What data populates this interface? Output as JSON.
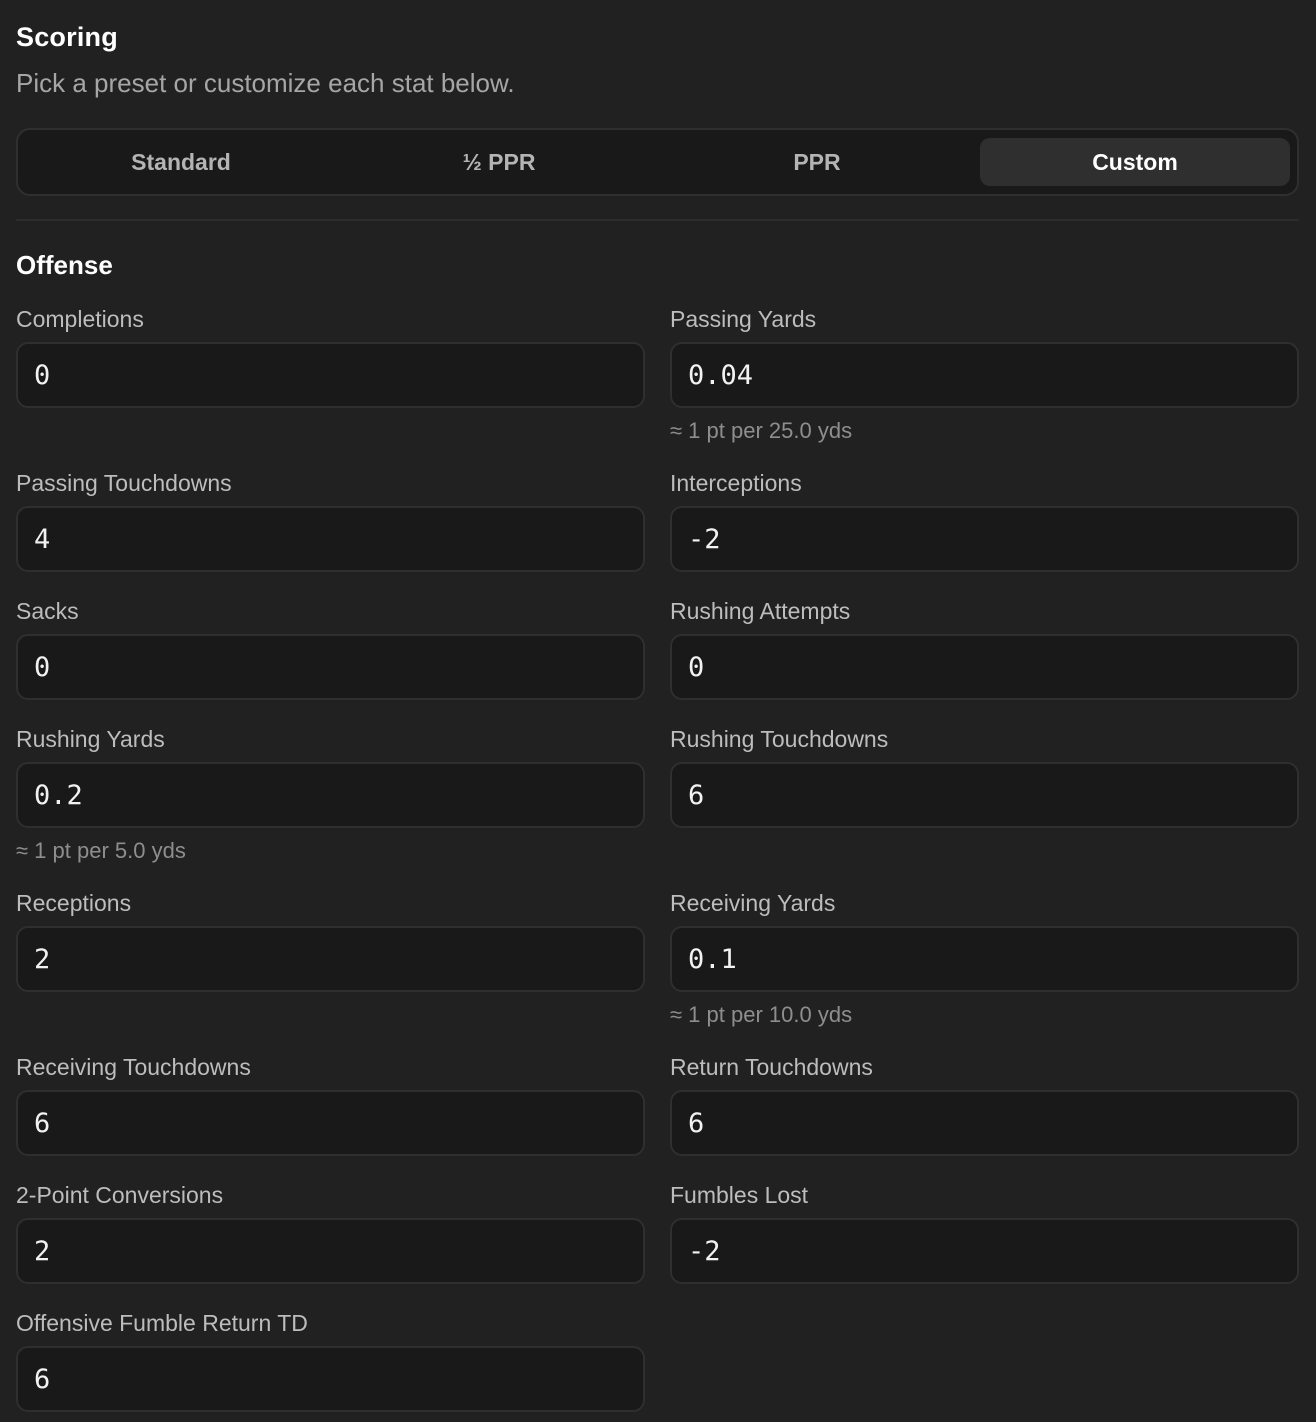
{
  "header": {
    "title": "Scoring",
    "subtitle": "Pick a preset or customize each stat below."
  },
  "presets": [
    {
      "label": "Standard",
      "active": false
    },
    {
      "label": "½ PPR",
      "active": false
    },
    {
      "label": "PPR",
      "active": false
    },
    {
      "label": "Custom",
      "active": true
    }
  ],
  "section": {
    "title": "Offense"
  },
  "fields": [
    {
      "label": "Completions",
      "value": "0",
      "hint": ""
    },
    {
      "label": "Passing Yards",
      "value": "0.04",
      "hint": "≈ 1 pt per 25.0 yds"
    },
    {
      "label": "Passing Touchdowns",
      "value": "4",
      "hint": ""
    },
    {
      "label": "Interceptions",
      "value": "-2",
      "hint": ""
    },
    {
      "label": "Sacks",
      "value": "0",
      "hint": ""
    },
    {
      "label": "Rushing Attempts",
      "value": "0",
      "hint": ""
    },
    {
      "label": "Rushing Yards",
      "value": "0.2",
      "hint": "≈ 1 pt per 5.0 yds"
    },
    {
      "label": "Rushing Touchdowns",
      "value": "6",
      "hint": ""
    },
    {
      "label": "Receptions",
      "value": "2",
      "hint": ""
    },
    {
      "label": "Receiving Yards",
      "value": "0.1",
      "hint": "≈ 1 pt per 10.0 yds"
    },
    {
      "label": "Receiving Touchdowns",
      "value": "6",
      "hint": ""
    },
    {
      "label": "Return Touchdowns",
      "value": "6",
      "hint": ""
    },
    {
      "label": "2-Point Conversions",
      "value": "2",
      "hint": ""
    },
    {
      "label": "Fumbles Lost",
      "value": "-2",
      "hint": ""
    },
    {
      "label": "Offensive Fumble Return TD",
      "value": "6",
      "hint": ""
    }
  ]
}
